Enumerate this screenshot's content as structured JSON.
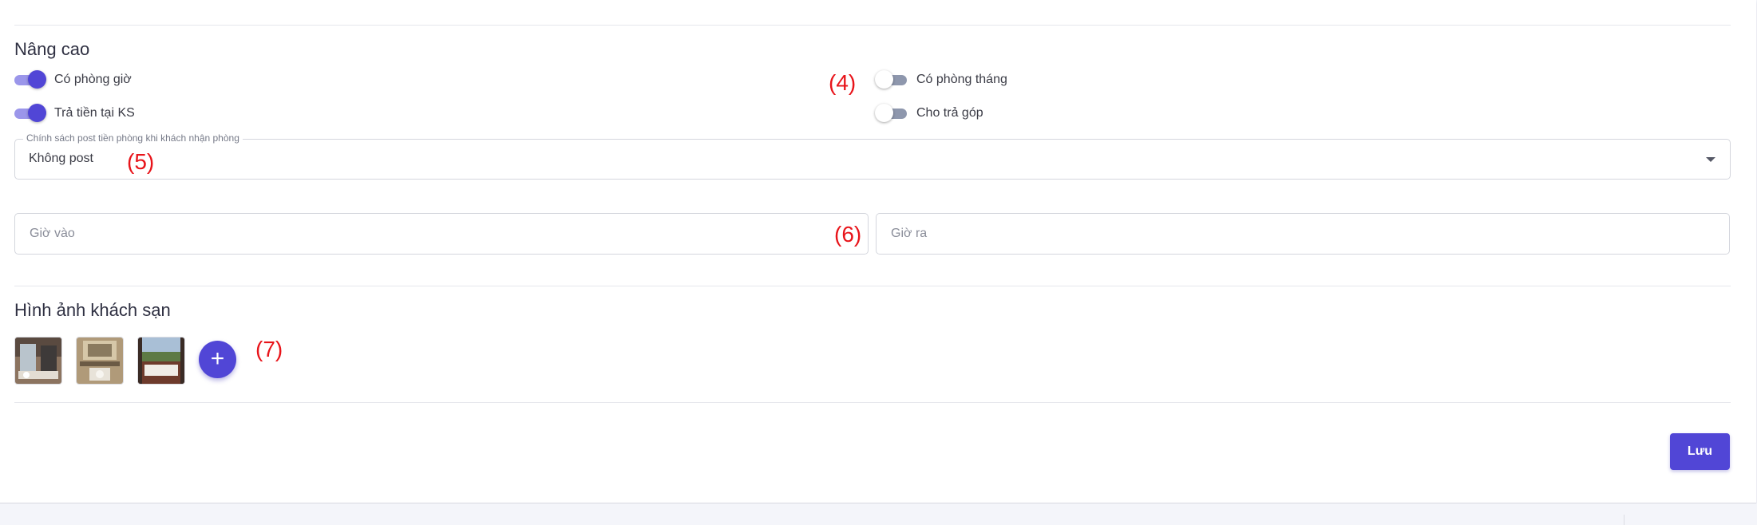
{
  "advanced": {
    "title": "Nâng cao",
    "toggles": {
      "hourly_room": {
        "label": "Có phòng giờ",
        "on": true
      },
      "pay_at_hotel": {
        "label": "Trả tiền tại KS",
        "on": true
      },
      "monthly_room": {
        "label": "Có phòng tháng",
        "on": false
      },
      "installment": {
        "label": "Cho trả góp",
        "on": false
      }
    }
  },
  "posting_policy": {
    "legend": "Chính sách post tiền phòng khi khách nhận phòng",
    "value": "Không post"
  },
  "checkin": {
    "placeholder": "Giờ vào",
    "value": ""
  },
  "checkout": {
    "placeholder": "Giờ ra",
    "value": ""
  },
  "images": {
    "title": "Hình ảnh khách sạn",
    "items": [
      "hotel-bathroom-photo",
      "hotel-bathroom-photo",
      "hotel-bedroom-view-photo"
    ],
    "add_icon": "plus-icon",
    "add_label": "+"
  },
  "save_label": "Lưu",
  "annotations": [
    "(4)",
    "(5)",
    "(6)",
    "(7)"
  ],
  "colors": {
    "accent": "#5146d6",
    "annotation": "#e8141a"
  }
}
